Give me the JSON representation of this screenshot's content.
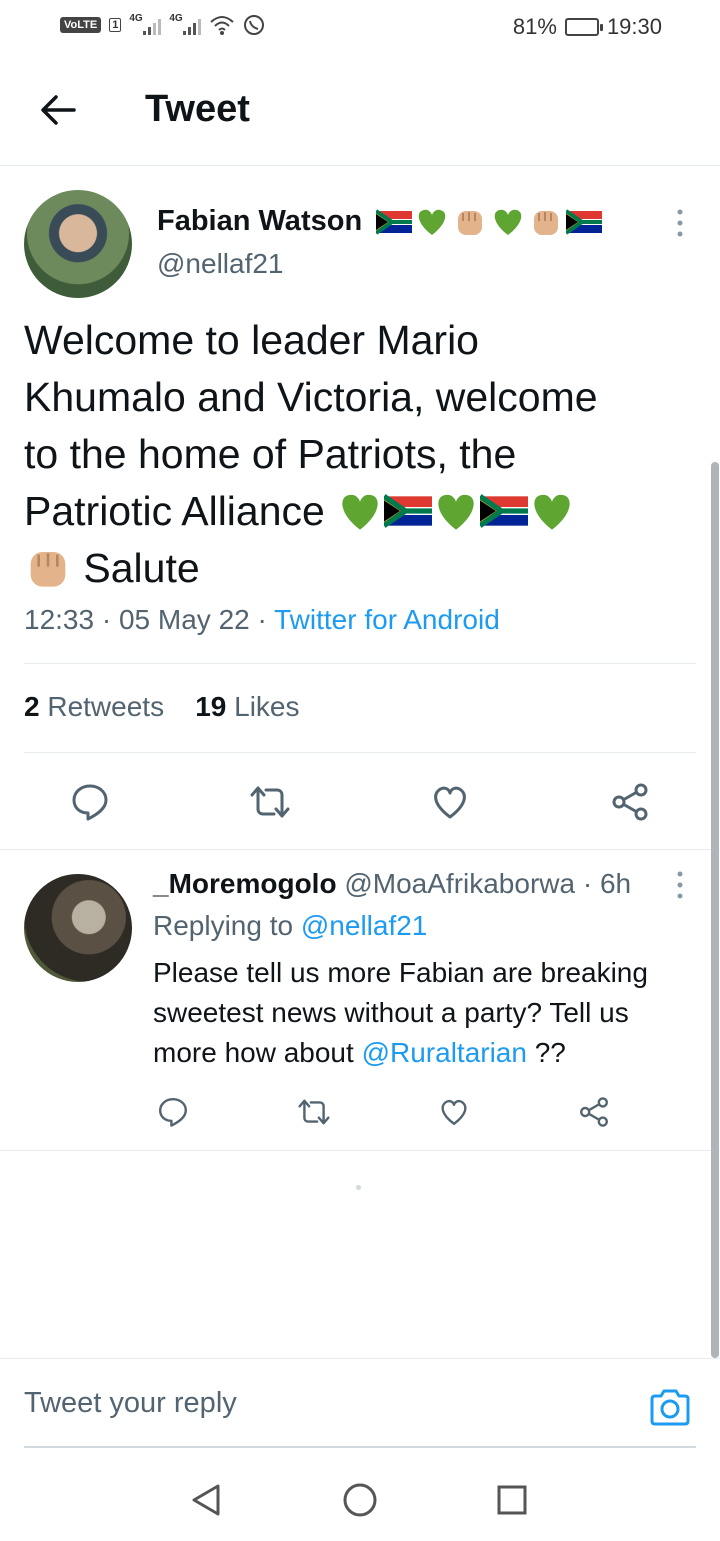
{
  "status_bar": {
    "volte": "VoLTE",
    "sim": "1",
    "net1": "4G",
    "net2": "4G",
    "battery": "81%",
    "time": "19:30"
  },
  "header": {
    "title": "Tweet",
    "back_icon": "arrow-left-icon"
  },
  "tweet": {
    "author_name": "Fabian Watson",
    "author_handle": "@nellaf21",
    "name_emojis": [
      "flag-za",
      "green-heart",
      "raised-fist",
      "green-heart",
      "raised-fist",
      "flag-za"
    ],
    "text_line1": "Welcome to leader Mario",
    "text_line2": "Khumalo and Victoria, welcome",
    "text_line3": "to the home of Patriots, the",
    "text_line4": "Patriotic Alliance",
    "text_line5_word": "Salute",
    "text_emojis": [
      "green-heart",
      "flag-za",
      "green-heart",
      "flag-za",
      "green-heart",
      "raised-fist"
    ],
    "time": "12:33",
    "date": "05 May 22",
    "source": "Twitter for Android",
    "sep": "·",
    "retweets_count": "2",
    "retweets_label": "Retweets",
    "likes_count": "19",
    "likes_label": "Likes"
  },
  "reply": {
    "name": "_Moremogolo",
    "handle": "@MoaAfrikaborwa",
    "age": "6h",
    "sep": "·",
    "replying_label": "Replying to",
    "replying_to": "@nellaf21",
    "text_part1": "Please tell us more Fabian are breaking sweetest news without a party? Tell us more how about",
    "mention": "@Ruraltarian",
    "text_part2": "??"
  },
  "reply_box": {
    "placeholder": "Tweet your reply"
  },
  "colors": {
    "link": "#1d9bf0",
    "secondary_text": "#536471",
    "primary_text": "#0f1419",
    "divider": "#e6ecf0"
  }
}
